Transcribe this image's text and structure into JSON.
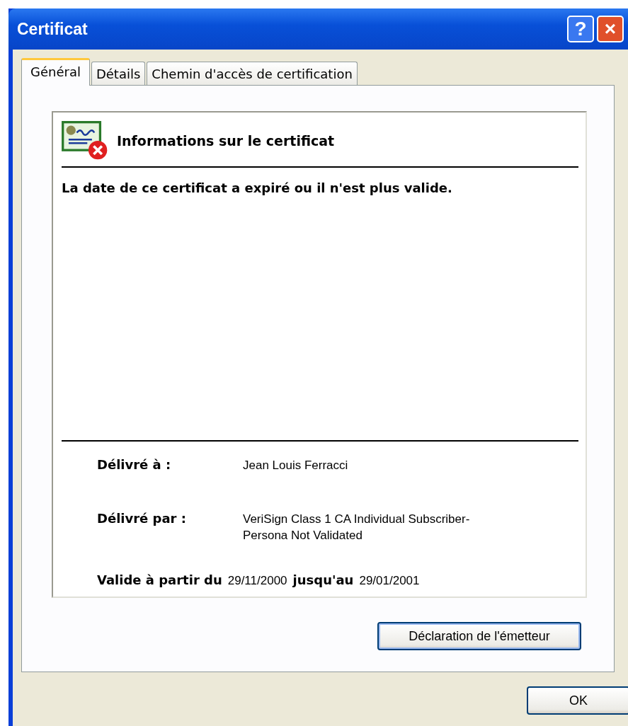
{
  "window": {
    "title": "Certificat"
  },
  "title_buttons": [
    {
      "kind": "help",
      "label": "?"
    },
    {
      "kind": "close",
      "label": "×"
    }
  ],
  "tabs": [
    {
      "label": "Général",
      "selected": true
    },
    {
      "label": "Détails",
      "selected": false
    },
    {
      "label": "Chemin d'accès de certification",
      "selected": false
    }
  ],
  "info": {
    "heading": "Informations sur le certificat",
    "status_invalid": true,
    "message": "La date de ce certificat a expiré ou il n'est plus valide.",
    "issued_to_label": "Délivré à :",
    "issued_to": "Jean Louis Ferracci",
    "issued_by_label": "Délivré par :",
    "issued_by": "VeriSign Class 1 CA Individual Subscriber-Persona Not Validated",
    "valid_from_label": "Valide à partir du",
    "valid_from": "29/11/2000",
    "valid_to_label": "jusqu'au",
    "valid_to": "29/01/2001"
  },
  "issuer_button": "Déclaration de l'émetteur",
  "buttons": [
    "OK"
  ]
}
